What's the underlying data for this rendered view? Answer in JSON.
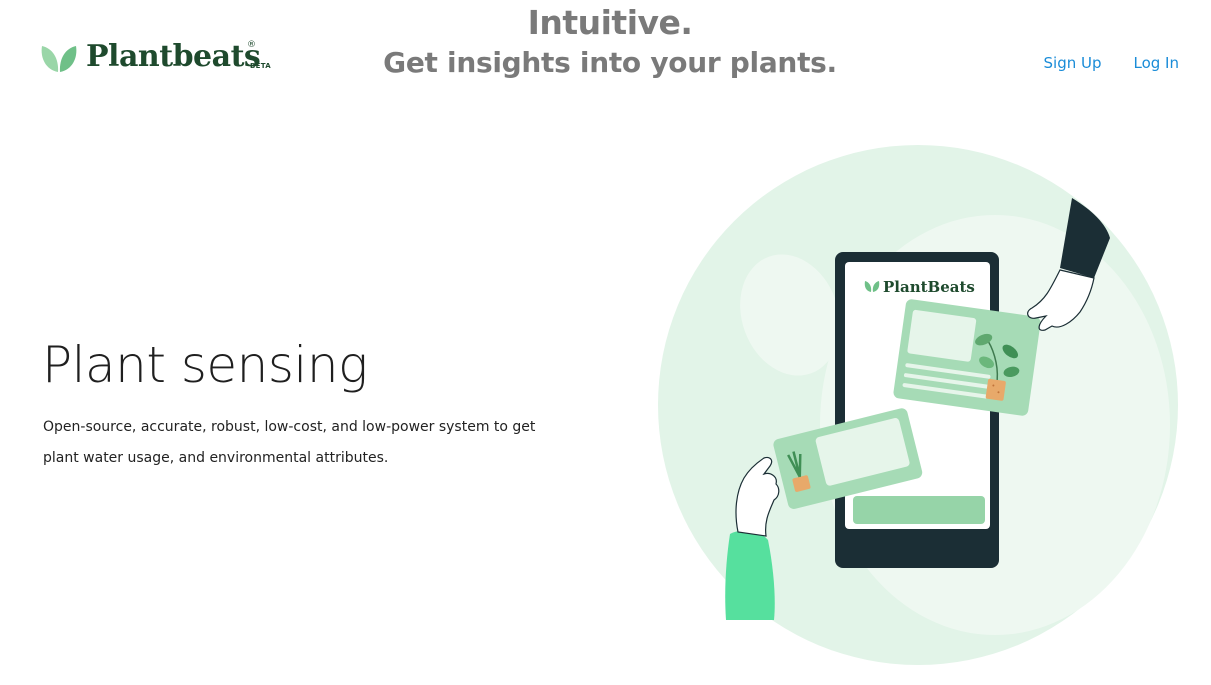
{
  "brand": {
    "name": "Plantbeats",
    "registered_mark": "®",
    "badge": "BETA"
  },
  "tagline": {
    "line1": "Intuitive.",
    "line2": "Get insights into your plants."
  },
  "nav": {
    "signup": "Sign Up",
    "login": "Log In"
  },
  "hero": {
    "title": "Plant sensing",
    "description": "Open-source, accurate, robust, low-cost, and low-power system to get plant water usage, and environmental attributes."
  },
  "illustration": {
    "phone_brand": "PlantBeats"
  },
  "colors": {
    "brand_green": "#1e4a2d",
    "leaf_green": "#7cc48f",
    "link_blue": "#1a8cd8",
    "tagline_gray": "#7a7a7a",
    "circle_light": "#e2f4e8",
    "phone_dark": "#1b2e35",
    "card_green": "#a6dbb6",
    "sleeve_green": "#56e09e"
  }
}
